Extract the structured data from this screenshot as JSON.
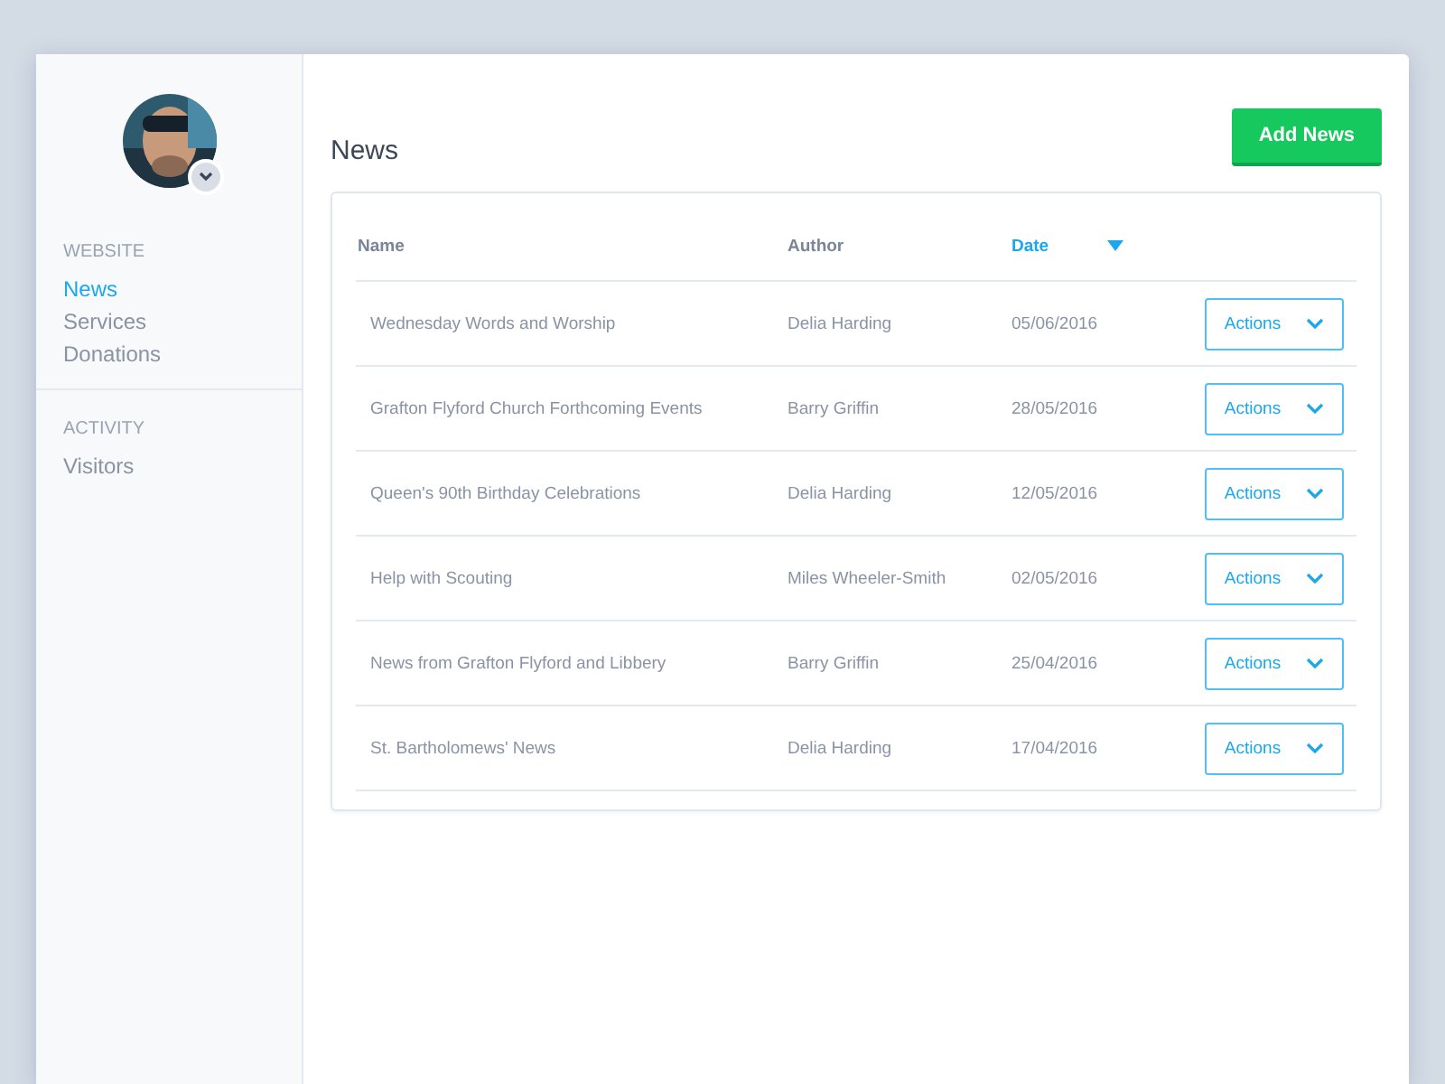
{
  "sidebar": {
    "sections": [
      {
        "heading": "WEBSITE",
        "items": [
          {
            "label": "News",
            "selected": true
          },
          {
            "label": "Services",
            "selected": false
          },
          {
            "label": "Donations",
            "selected": false
          }
        ]
      },
      {
        "heading": "ACTIVITY",
        "items": [
          {
            "label": "Visitors",
            "selected": false
          }
        ]
      }
    ]
  },
  "page": {
    "title": "News",
    "add_button": "Add News"
  },
  "table": {
    "columns": [
      {
        "label": "Name",
        "sorted": false
      },
      {
        "label": "Author",
        "sorted": false
      },
      {
        "label": "Date",
        "sorted": true
      }
    ],
    "rows": [
      {
        "name": "Wednesday Words and Worship",
        "author": "Delia Harding",
        "date": "05/06/2016",
        "action": "Actions"
      },
      {
        "name": "Grafton Flyford Church Forthcoming Events",
        "author": "Barry Griffin",
        "date": "28/05/2016",
        "action": "Actions"
      },
      {
        "name": "Queen's 90th Birthday Celebrations",
        "author": "Delia Harding",
        "date": "12/05/2016",
        "action": "Actions"
      },
      {
        "name": "Help with Scouting",
        "author": "Miles Wheeler-Smith",
        "date": "02/05/2016",
        "action": "Actions"
      },
      {
        "name": "News from Grafton Flyford and Libbery",
        "author": "Barry Griffin",
        "date": "25/04/2016",
        "action": "Actions"
      },
      {
        "name": "St. Bartholomews' News",
        "author": "Delia Harding",
        "date": "17/04/2016",
        "action": "Actions"
      }
    ]
  }
}
